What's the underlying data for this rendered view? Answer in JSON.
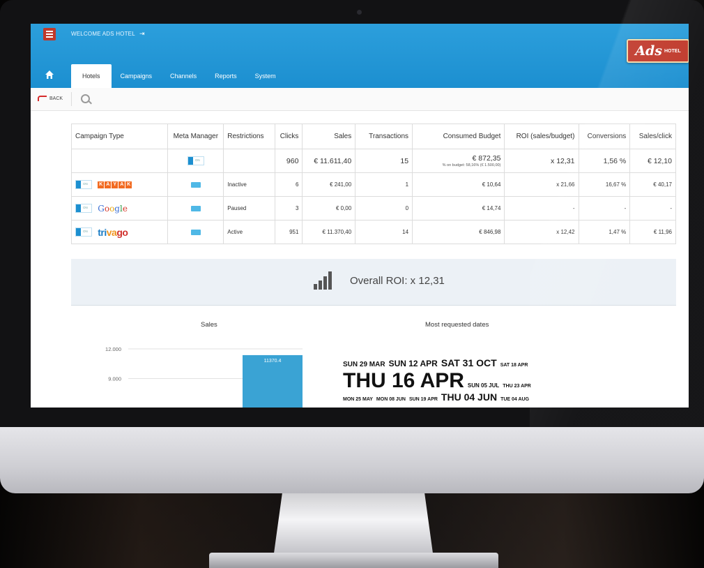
{
  "header": {
    "welcome": "WELCOME ADS HOTEL",
    "logo_main": "Ads",
    "logo_sub": "HOTEL"
  },
  "tabs": [
    {
      "label": "Hotels",
      "active": true
    },
    {
      "label": "Campaigns",
      "active": false
    },
    {
      "label": "Channels",
      "active": false
    },
    {
      "label": "Reports",
      "active": false
    },
    {
      "label": "System",
      "active": false
    }
  ],
  "toolbar": {
    "back_label": "BACK"
  },
  "table": {
    "headers": [
      "Campaign Type",
      "Meta Manager",
      "Restrictions",
      "Clicks",
      "Sales",
      "Transactions",
      "Consumed Budget",
      "ROI (sales/budget)",
      "Conversions",
      "Sales/click"
    ],
    "toggle_label": "ON",
    "summary": {
      "clicks": "960",
      "sales": "€ 11.611,40",
      "transactions": "15",
      "consumed_budget": "€ 872,35",
      "budget_note": "% on budget: 58,16% (€ 1.500,00)",
      "roi": "x 12,31",
      "conversions": "1,56 %",
      "sales_click": "€ 12,10"
    },
    "rows": [
      {
        "channel": "KAYAK",
        "kayak_letters": [
          "K",
          "A",
          "Y",
          "A",
          "K"
        ],
        "restriction": "Inactive",
        "clicks": "6",
        "sales": "€ 241,00",
        "transactions": "1",
        "consumed_budget": "€ 10,64",
        "roi": "x 21,66",
        "conversions": "16,67 %",
        "sales_click": "€ 40,17"
      },
      {
        "channel": "Google",
        "restriction": "Paused",
        "clicks": "3",
        "sales": "€ 0,00",
        "transactions": "0",
        "consumed_budget": "€ 14,74",
        "roi": "-",
        "conversions": "-",
        "sales_click": "-"
      },
      {
        "channel": "trivago",
        "restriction": "Active",
        "clicks": "951",
        "sales": "€ 11.370,40",
        "transactions": "14",
        "consumed_budget": "€ 846,98",
        "roi": "x 12,42",
        "conversions": "1,47 %",
        "sales_click": "€ 11,96"
      }
    ]
  },
  "roi_banner": {
    "text": "Overall ROI: x 12,31"
  },
  "chart_data": {
    "type": "bar",
    "title": "Sales",
    "y_ticks": [
      "12.000",
      "9.000"
    ],
    "y_tick_values": [
      12000,
      9000
    ],
    "bars": [
      {
        "value": 11370.4,
        "label": "11370.4"
      }
    ],
    "ylim": [
      0,
      12000
    ]
  },
  "dates_panel": {
    "title": "Most requested dates",
    "rows": [
      [
        {
          "text": "SUN 29 MAR",
          "size": 10
        },
        {
          "text": "SUN 12 APR",
          "size": 12
        },
        {
          "text": "SAT 31 OCT",
          "size": 14
        },
        {
          "text": "SAT 18 APR",
          "size": 7
        }
      ],
      [
        {
          "text": "THU 16 APR",
          "size": 30
        },
        {
          "text": "SUN 05 JUL",
          "size": 8
        },
        {
          "text": "THU 23 APR",
          "size": 7
        }
      ],
      [
        {
          "text": "MON 25 MAY",
          "size": 7
        },
        {
          "text": "MON 08 JUN",
          "size": 7
        },
        {
          "text": "SUN 19 APR",
          "size": 7
        },
        {
          "text": "THU 04 JUN",
          "size": 14
        },
        {
          "text": "TUE 04 AUG",
          "size": 7
        }
      ]
    ]
  },
  "colors": {
    "header_blue": "#1c8fd0",
    "bar_blue": "#3aa3d4",
    "logo_red": "#c0392b"
  }
}
